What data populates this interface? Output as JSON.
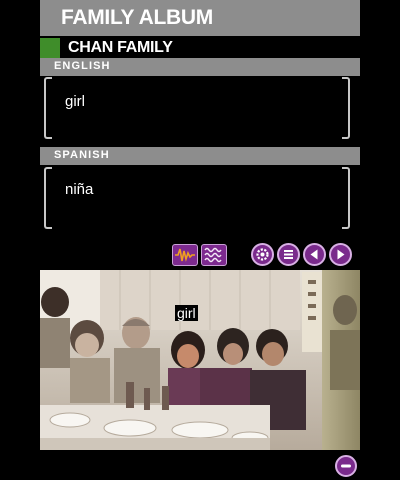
{
  "header": {
    "title": "FAMILY ALBUM"
  },
  "subheader": {
    "name": "CHAN FAMILY",
    "accent_color": "#3f8d2a"
  },
  "english": {
    "label": "ENGLISH",
    "text": "girl"
  },
  "spanish": {
    "label": "SPANISH",
    "text": "niña"
  },
  "controls": {
    "left_buttons": [
      "waveform-slow-icon",
      "waveform-text-icon"
    ],
    "right_buttons": [
      "gear-icon",
      "menu-icon",
      "previous-icon",
      "next-icon"
    ],
    "accent_color": "#7d2a8f"
  },
  "photo": {
    "hotspot_label": "girl"
  },
  "footer": {
    "button": "minus-icon"
  }
}
